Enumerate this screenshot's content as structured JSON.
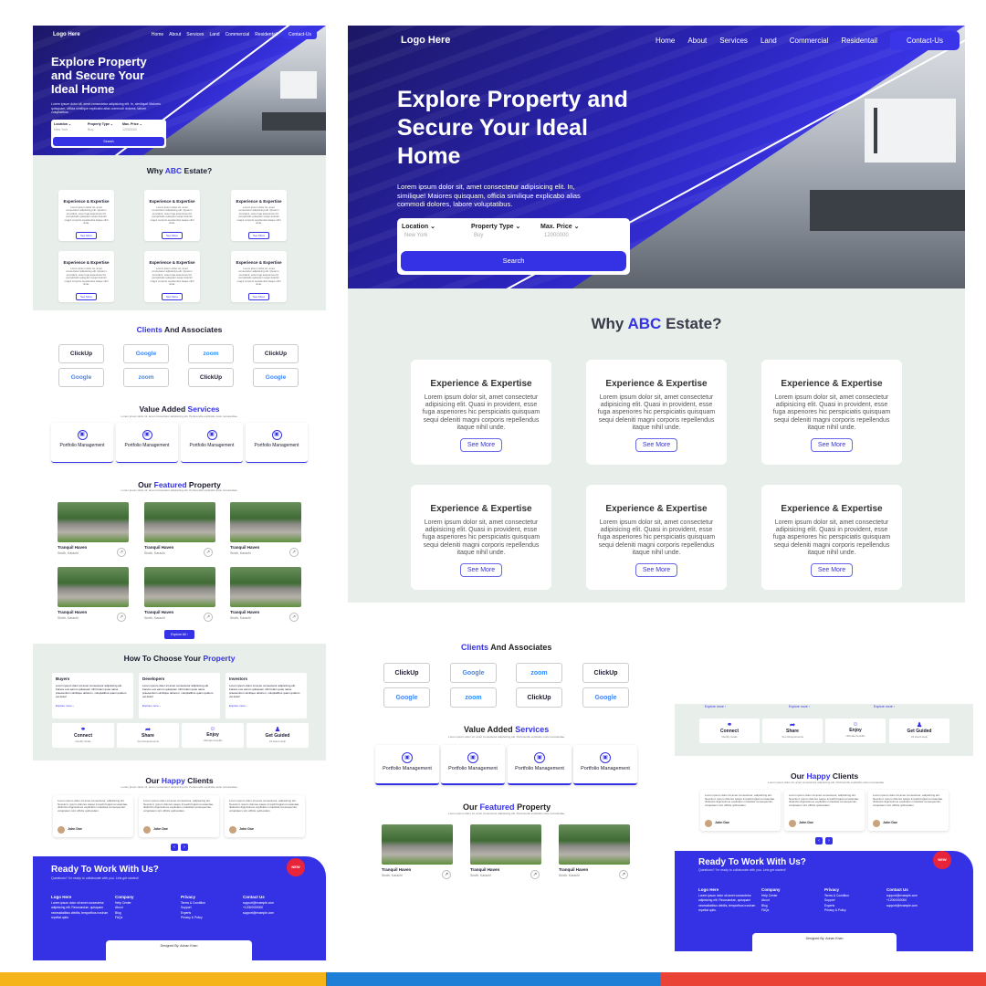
{
  "nav": {
    "logo": "Logo Here",
    "links": [
      "Home",
      "About",
      "Services",
      "Land",
      "Commercial",
      "Residentail"
    ],
    "contact": "Contact-Us"
  },
  "hero": {
    "title": "Explore Property and Secure Your Ideal Home",
    "para": "Lorem ipsum dolor sit, amet consectetur adipisicing elit. In, similique! Maiores quisquam, officia similique explicabo alias commodi dolores, labore voluptatibus.",
    "search": {
      "location_label": "Location ⌄",
      "location_value": "New York",
      "type_label": "Property Type ⌄",
      "type_value": "Buy",
      "price_label": "Max. Price ⌄",
      "price_value": "12000000",
      "button": "Search"
    }
  },
  "why": {
    "title_pre": "Why",
    "title_brand": "ABC",
    "title_post": "Estate?",
    "card_title": "Experience & Expertise",
    "card_text": "Lorem ipsum dolor sit, amet consectetur adipisicing elit. Quasi in provident, esse fuga asperiores hic perspiciatis quisquam sequi deleniti magni corporis repellendus itaque nihil unde.",
    "card_button": "See More"
  },
  "clients": {
    "title_brand": "Clients",
    "title_post": "And Associates",
    "logos": [
      "ClickUp",
      "Google",
      "zoom",
      "ClickUp",
      "Google",
      "zoom",
      "ClickUp",
      "Google"
    ]
  },
  "services": {
    "title_pre": "Value Added",
    "title_brand": "Services",
    "subtitle": "Lorem ipsum dolor sit, amet consectetur adipisicing elit. Perferendis explicabo iusto recusandae.",
    "item": "Portfolio Management"
  },
  "featured": {
    "title_pre": "Our",
    "title_brand": "Featured",
    "title_post": "Property",
    "subtitle": "Lorem ipsum dolor sit, amet consectetur adipisicing elit. Perferendis explicabo iusto recusandae.",
    "name": "Tranquil Haven",
    "location": "Sindh, Karachi",
    "button": "Explore All ›"
  },
  "choose": {
    "title_pre": "How To Choose Your",
    "title_brand": "Property",
    "cols": [
      "Buyers",
      "Developers",
      "Investors"
    ],
    "text": "Lorem ipsum dolor sit amet consectetur adipisicing elit. Facere eos earum quisquam nihil totam quas natus praesentium similique dolorum, voluptatibus quam quidem vel dolor!",
    "more": "Explore more ›",
    "steps": [
      {
        "label": "Connect",
        "sub": "Identify Goals"
      },
      {
        "label": "Share",
        "sub": "Your Requirements"
      },
      {
        "label": "Enjoy",
        "sub": "Ultimate benefits"
      },
      {
        "label": "Get Guided",
        "sub": "24 Hours Help"
      }
    ]
  },
  "happy": {
    "title_pre": "Our",
    "title_brand": "Happy",
    "title_post": "Clients",
    "subtitle": "Lorem ipsum dolor sit, amet consectetur adipisicing elit. Perferendis explicabo iusto recusandae.",
    "review": "Lorem ipsum dolor sit amet consectetur, adipisicing elit. Nesciunt, ipsum dolores saepe impedit fugiat recusandae, distinctio dignissimos explicabo molestias consequuntur, voluptatem sint officiis quibusdam.",
    "name": "John Doe",
    "role": "CEO, XYZ"
  },
  "footer": {
    "title": "Ready To Work With Us?",
    "subtitle": "Questions? I'm ready to collaborate with you. Lets get started!",
    "logo": "Logo Here",
    "about": "Lorem ipsum dolor sit amet consectetur adipisicing elit. Recusandae, quisquam necessitatibus debitis, temporibus nostrum repellat optio.",
    "company_title": "Company",
    "company": [
      "Help Center",
      "About",
      "Blog",
      "FAQs"
    ],
    "privacy_title": "Privacy",
    "privacy": [
      "Terms & Condition",
      "Support",
      "Experts",
      "Privacy & Policy"
    ],
    "contact_title": "Contact Us",
    "contact": [
      "support@example.com",
      "+12000000000",
      "support@example.com"
    ],
    "designed": "Designed By: Adnan Khan",
    "badge": "NEW"
  }
}
